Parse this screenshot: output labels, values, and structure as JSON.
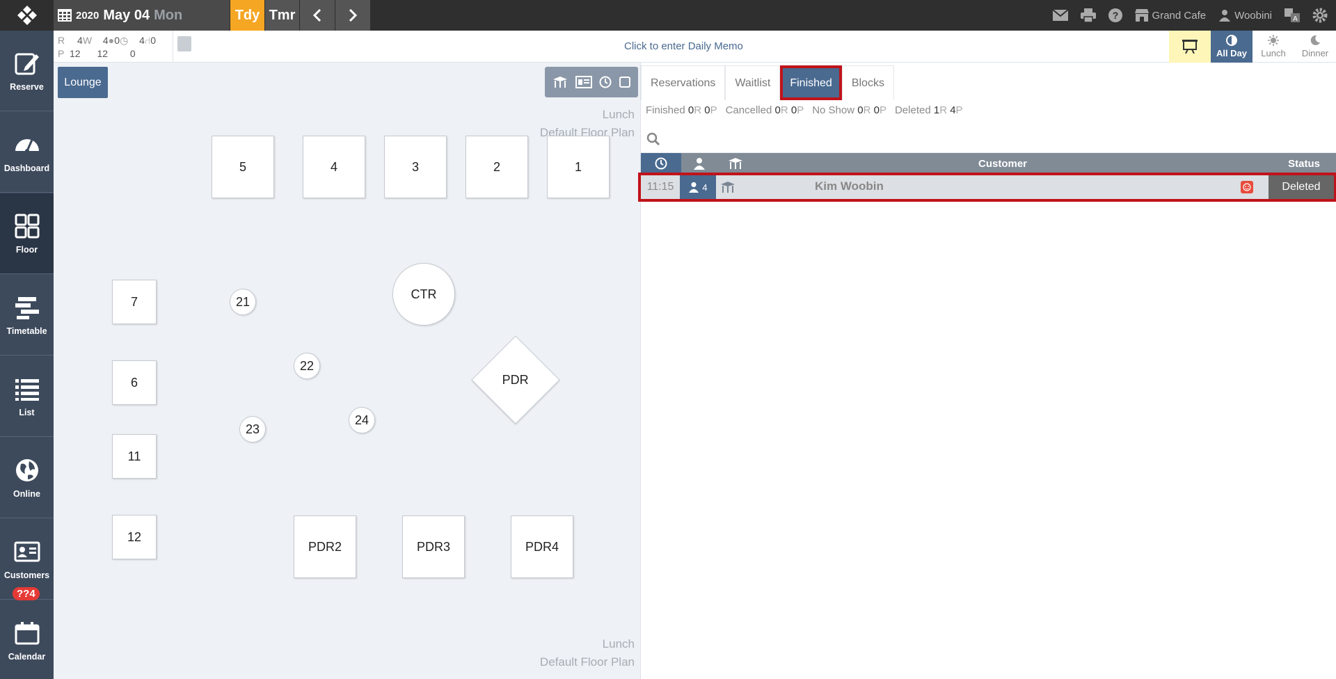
{
  "header": {
    "date_year": "2020",
    "date_monthday": "May 04",
    "date_dow": "Mon",
    "today_label": "Tdy",
    "tomorrow_label": "Tmr",
    "restaurant": "Grand Cafe",
    "user": "Woobini"
  },
  "sidebar": {
    "items": [
      {
        "label": "Reserve",
        "icon": "edit-icon"
      },
      {
        "label": "Dashboard",
        "icon": "gauge-icon"
      },
      {
        "label": "Floor",
        "icon": "grid-icon"
      },
      {
        "label": "Timetable",
        "icon": "timetable-icon"
      },
      {
        "label": "List",
        "icon": "list-icon"
      },
      {
        "label": "Online",
        "icon": "globe-icon"
      },
      {
        "label": "Customers",
        "icon": "id-card-icon"
      },
      {
        "label": "Calendar",
        "icon": "calendar-icon"
      }
    ],
    "calendar_badge": "??4"
  },
  "counts": {
    "r_label": "R",
    "r1": "4",
    "w_label": "W",
    "w": "4",
    "online": "0",
    "clock": "0",
    "chair_r": "4",
    "seat_r": "0",
    "p_label": "P",
    "p1": "12",
    "p2": "12",
    "p3": "0",
    "p4": "12",
    "p5": "0"
  },
  "memo": "Click to enter Daily Memo",
  "shifts": [
    {
      "label": "All Day",
      "icon": "half-circle-icon"
    },
    {
      "label": "Lunch",
      "icon": "sun-icon"
    },
    {
      "label": "Dinner",
      "icon": "moon-icon"
    }
  ],
  "floor": {
    "area_tab": "Lounge",
    "label_shift": "Lunch",
    "label_plan": "Default Floor Plan",
    "tables": [
      "5",
      "4",
      "3",
      "2",
      "1",
      "7",
      "21",
      "CTR",
      "22",
      "PDR",
      "6",
      "24",
      "23",
      "11",
      "12",
      "PDR2",
      "PDR3",
      "PDR4"
    ]
  },
  "tabs": [
    "Reservations",
    "Waitlist",
    "Finished",
    "Blocks"
  ],
  "stats": {
    "finished_label": "Finished",
    "finished_r": "0",
    "finished_p": "0",
    "cancelled_label": "Cancelled",
    "cancelled_r": "0",
    "cancelled_p": "0",
    "noshow_label": "No Show",
    "noshow_r": "0",
    "noshow_p": "0",
    "deleted_label": "Deleted",
    "deleted_r": "1",
    "deleted_p": "4",
    "r_unit": "R",
    "p_unit": "P"
  },
  "table_header": {
    "customer": "Customer",
    "status": "Status"
  },
  "rows": [
    {
      "time": "11:15",
      "party": "4",
      "name": "Kim Woobin",
      "status": "Deleted"
    }
  ],
  "colors": {
    "accent": "#4a6a90",
    "today": "#f5a623",
    "highlight": "#c0131b"
  }
}
